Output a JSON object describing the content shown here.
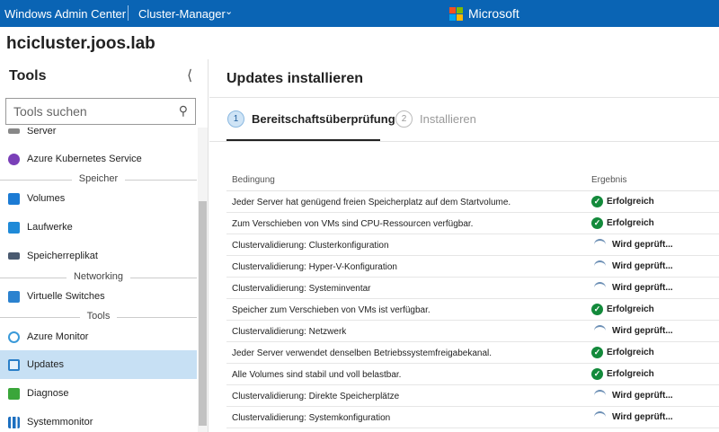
{
  "topbar": {
    "app": "Windows Admin Center",
    "context": "Cluster-Manager",
    "brand": "Microsoft"
  },
  "host": "hcicluster.joos.lab",
  "sidebar": {
    "title": "Tools",
    "search_placeholder": "Tools suchen",
    "items": [
      {
        "label": "Server"
      },
      {
        "label": "Azure Kubernetes Service"
      },
      {
        "label": "Volumes"
      },
      {
        "label": "Laufwerke"
      },
      {
        "label": "Speicherreplikat"
      },
      {
        "label": "Virtuelle Switches"
      },
      {
        "label": "Azure Monitor"
      },
      {
        "label": "Updates",
        "selected": true
      },
      {
        "label": "Diagnose"
      },
      {
        "label": "Systemmonitor"
      }
    ],
    "groups": [
      "Speicher",
      "Networking",
      "Tools"
    ]
  },
  "main": {
    "title": "Updates installieren",
    "steps": [
      {
        "num": "1",
        "label": "Bereitschaftsüberprüfung"
      },
      {
        "num": "2",
        "label": "Installieren"
      }
    ],
    "columns": [
      "Bedingung",
      "Ergebnis"
    ],
    "rows": [
      {
        "c": "Jeder Server hat genügend freien Speicherplatz auf dem Startvolume.",
        "r": "Erfolgreich",
        "s": "ok"
      },
      {
        "c": "Zum Verschieben von VMs sind CPU-Ressourcen verfügbar.",
        "r": "Erfolgreich",
        "s": "ok"
      },
      {
        "c": "Clustervalidierung: Clusterkonfiguration",
        "r": "Wird geprüft...",
        "s": "spin"
      },
      {
        "c": "Clustervalidierung: Hyper-V-Konfiguration",
        "r": "Wird geprüft...",
        "s": "spin"
      },
      {
        "c": "Clustervalidierung: Systeminventar",
        "r": "Wird geprüft...",
        "s": "spin"
      },
      {
        "c": "Speicher zum Verschieben von VMs ist verfügbar.",
        "r": "Erfolgreich",
        "s": "ok"
      },
      {
        "c": "Clustervalidierung: Netzwerk",
        "r": "Wird geprüft...",
        "s": "spin"
      },
      {
        "c": "Jeder Server verwendet denselben Betriebssystemfreigabekanal.",
        "r": "Erfolgreich",
        "s": "ok"
      },
      {
        "c": "Alle Volumes sind stabil und voll belastbar.",
        "r": "Erfolgreich",
        "s": "ok"
      },
      {
        "c": "Clustervalidierung: Direkte Speicherplätze",
        "r": "Wird geprüft...",
        "s": "spin"
      },
      {
        "c": "Clustervalidierung: Systemkonfiguration",
        "r": "Wird geprüft...",
        "s": "spin"
      }
    ]
  }
}
